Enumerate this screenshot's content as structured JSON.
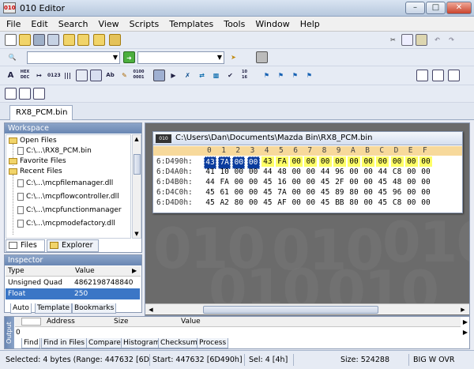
{
  "window": {
    "title": "010 Editor",
    "app_icon": "010"
  },
  "menu": [
    "File",
    "Edit",
    "Search",
    "View",
    "Scripts",
    "Templates",
    "Tools",
    "Window",
    "Help"
  ],
  "file_tab": "RX8_PCM.bin",
  "workspace": {
    "title": "Workspace",
    "tree": [
      {
        "label": "Open Files",
        "icon": "folder-icon"
      },
      {
        "label": "C:\\...\\RX8_PCM.bin",
        "icon": "file-icon"
      },
      {
        "label": "Favorite Files",
        "icon": "folder-icon"
      },
      {
        "label": "Recent Files",
        "icon": "folder-icon"
      },
      {
        "label": "C:\\...\\mcpfilemanager.dll",
        "icon": "file-icon"
      },
      {
        "label": "C:\\...\\mcpflowcontroller.dll",
        "icon": "file-icon"
      },
      {
        "label": "C:\\...\\mcpfunctionmanager",
        "icon": "file-icon"
      },
      {
        "label": "C:\\...\\mcpmodefactory.dll",
        "icon": "file-icon"
      }
    ],
    "tabs": [
      "Files",
      "Explorer"
    ]
  },
  "inspector": {
    "title": "Inspector",
    "columns": [
      "Type",
      "Value"
    ],
    "rows": [
      {
        "type": "Unsigned Quad",
        "value": "4862198748840"
      },
      {
        "type": "Float",
        "value": "250"
      }
    ],
    "tabs": [
      "Auto",
      "Template",
      "Bookmarks"
    ]
  },
  "hex": {
    "path": "C:\\Users\\Dan\\Documents\\Mazda Bin\\RX8_PCM.bin",
    "columns": [
      "0",
      "1",
      "2",
      "3",
      "4",
      "5",
      "6",
      "7",
      "8",
      "9",
      "A",
      "B",
      "C",
      "D",
      "E",
      "F"
    ],
    "rows": [
      {
        "addr": "6:D490h:",
        "bytes": [
          "43",
          "7A",
          "00",
          "00",
          "43",
          "FA",
          "00",
          "00",
          "00",
          "00",
          "00",
          "00",
          "00",
          "00",
          "00",
          "00"
        ]
      },
      {
        "addr": "6:D4A0h:",
        "bytes": [
          "41",
          "10",
          "00",
          "00",
          "44",
          "48",
          "00",
          "00",
          "44",
          "96",
          "00",
          "00",
          "44",
          "C8",
          "00",
          "00"
        ]
      },
      {
        "addr": "6:D4B0h:",
        "bytes": [
          "44",
          "FA",
          "00",
          "00",
          "45",
          "16",
          "00",
          "00",
          "45",
          "2F",
          "00",
          "00",
          "45",
          "48",
          "00",
          "00"
        ]
      },
      {
        "addr": "6:D4C0h:",
        "bytes": [
          "45",
          "61",
          "00",
          "00",
          "45",
          "7A",
          "00",
          "00",
          "45",
          "89",
          "80",
          "00",
          "45",
          "96",
          "00",
          "00"
        ]
      },
      {
        "addr": "6:D4D0h:",
        "bytes": [
          "45",
          "A2",
          "80",
          "00",
          "45",
          "AF",
          "00",
          "00",
          "45",
          "BB",
          "80",
          "00",
          "45",
          "C8",
          "00",
          "00"
        ]
      }
    ]
  },
  "output": {
    "columns": [
      "Address",
      "Size",
      "Value"
    ],
    "first_row": "0",
    "side_label": "Output",
    "tabs": [
      "Find",
      "Find in Files",
      "Compare",
      "Histogram",
      "Checksum",
      "Process"
    ]
  },
  "status": {
    "selected": "Selected: 4 bytes (Range: 447632 [6D490h] to 447635 [6D493h])",
    "start": "Start: 447632 [6D490h]",
    "sel": "Sel: 4 [4h]",
    "size": "Size: 524288",
    "mode": "BIG W OVR"
  },
  "watermark": "010"
}
